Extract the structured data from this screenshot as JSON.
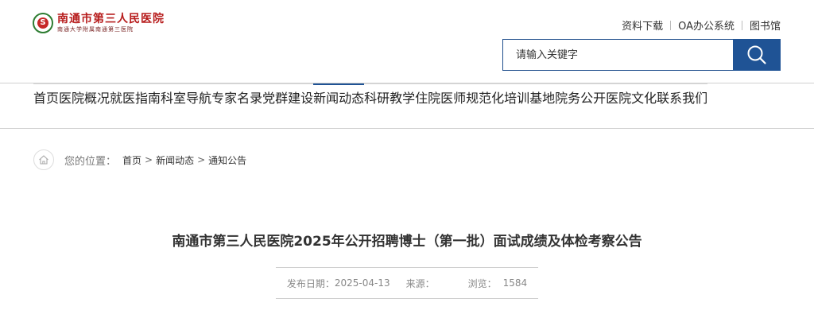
{
  "header": {
    "logo_cn": "南通市第三人民医院",
    "logo_sub": "南通大学附属南通第三医院",
    "logo_emblem_char": "S"
  },
  "toplinks": [
    "资料下载",
    "OA办公系统",
    "图书馆"
  ],
  "search": {
    "placeholder": "请输入关键字",
    "icon": "search-icon"
  },
  "nav": {
    "items": [
      "首页",
      "医院概况",
      "就医指南",
      "科室导航",
      "专家名录",
      "党群建设",
      "新闻动态",
      "科研教学",
      "住院医师规范化培训基地",
      "院务公开",
      "医院文化",
      "联系我们"
    ],
    "active": "新闻动态"
  },
  "breadcrumb": {
    "label": "您的位置：",
    "items": [
      "首页",
      "新闻动态",
      "通知公告"
    ],
    "separator": ">",
    "icon": "home-icon"
  },
  "article": {
    "title": "南通市第三人民医院2025年公开招聘博士（第一批）面试成绩及体检考察公告",
    "date_label": "发布日期：",
    "date": "2025-04-13",
    "source_label": "来源：",
    "source": "",
    "views_label": "浏览：",
    "views": "1584"
  },
  "colors": {
    "brand": "#1f5395",
    "logo_red": "#b71c1c",
    "logo_green": "#2e7d32"
  }
}
